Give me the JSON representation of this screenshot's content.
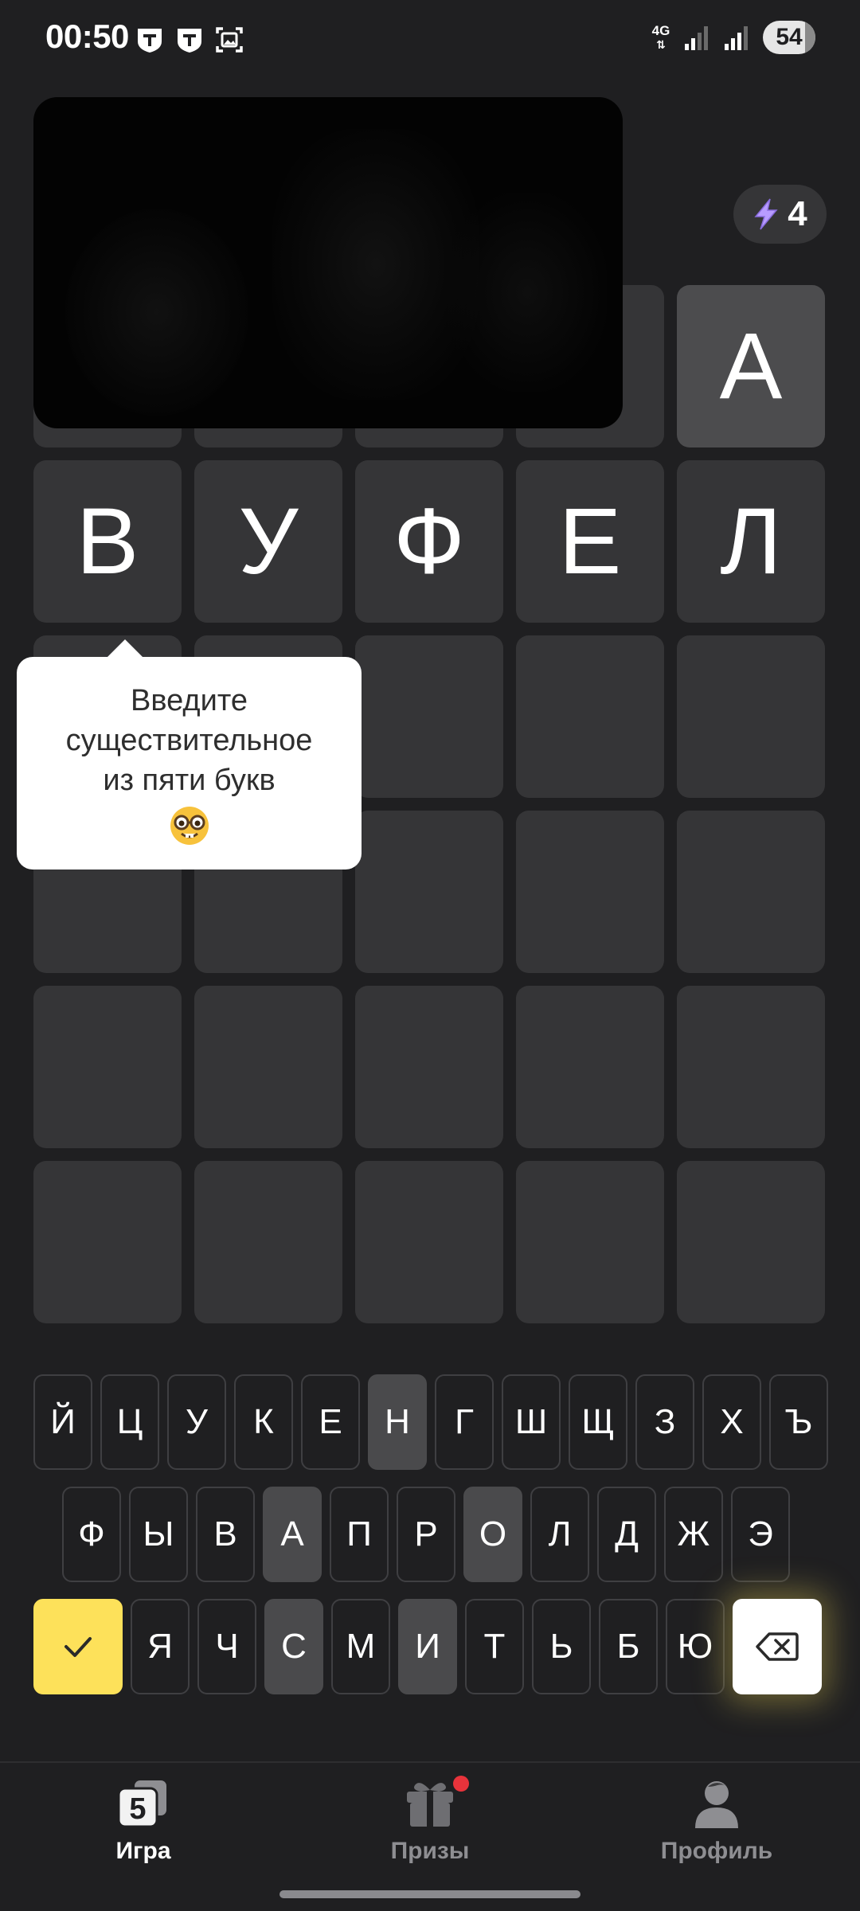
{
  "status_bar": {
    "time": "00:50",
    "network": "4G",
    "battery": "54",
    "battery_level_percent": 54
  },
  "energy": {
    "count": "4",
    "icon": "lightning-icon"
  },
  "grid": {
    "rows": [
      [
        "",
        "",
        "",
        "",
        "А"
      ],
      [
        "В",
        "У",
        "Ф",
        "Е",
        "Л"
      ],
      [
        "",
        "",
        "",
        "",
        ""
      ],
      [
        "",
        "",
        "",
        "",
        ""
      ],
      [
        "",
        "",
        "",
        "",
        ""
      ],
      [
        "",
        "",
        "",
        "",
        ""
      ]
    ]
  },
  "tooltip": {
    "line1": "Введите",
    "line2": "существительное",
    "line3": "из пяти букв",
    "emoji": "nerd-face-icon"
  },
  "keyboard": {
    "row1": [
      "Й",
      "Ц",
      "У",
      "К",
      "Е",
      "Н",
      "Г",
      "Ш",
      "Щ",
      "З",
      "Х",
      "Ъ"
    ],
    "row2": [
      "Ф",
      "Ы",
      "В",
      "А",
      "П",
      "Р",
      "О",
      "Л",
      "Д",
      "Ж",
      "Э"
    ],
    "row3": [
      "Я",
      "Ч",
      "С",
      "М",
      "И",
      "Т",
      "Ь",
      "Б",
      "Ю"
    ],
    "used_letters": [
      "Н",
      "А",
      "О",
      "С",
      "И"
    ],
    "enter_icon": "checkmark-icon",
    "backspace_icon": "backspace-icon"
  },
  "nav": {
    "game": "Игра",
    "prizes": "Призы",
    "profile": "Профиль",
    "active": "game",
    "colors": {
      "active": "#ffffff",
      "inactive": "#8e8e92",
      "badge": "#e8333b"
    }
  },
  "colors": {
    "background": "#1f1f21",
    "tile": "#353537",
    "tile_filled": "#4c4c4e",
    "key_used": "#4a4a4c",
    "enter_key": "#fde15a",
    "energy_icon": "#b89cff"
  }
}
